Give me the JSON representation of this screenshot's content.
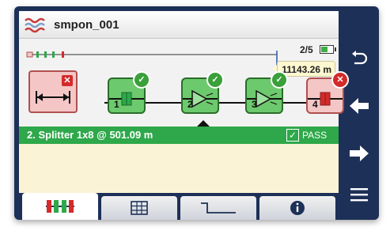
{
  "header": {
    "logo_icon": "wave-logo-icon",
    "title": "smpon_001",
    "page_indicator": "2/5",
    "battery_level": 0.6
  },
  "trace": {
    "cursor_distance": "11143.26 m",
    "launch_status": "fail",
    "events": [
      {
        "number": "1",
        "icon": "connector-icon",
        "status": "pass"
      },
      {
        "number": "2",
        "icon": "splitter-icon",
        "status": "pass"
      },
      {
        "number": "3",
        "icon": "splitter-icon",
        "status": "pass"
      },
      {
        "number": "4",
        "icon": "connector-icon",
        "status": "fail"
      }
    ],
    "selected_event": 2
  },
  "status": {
    "event_summary": "2. Splitter 1x8 @ 501.09 m",
    "verdict": "PASS"
  },
  "tabs": [
    {
      "icon": "link-view-icon",
      "active": true
    },
    {
      "icon": "table-icon",
      "active": false
    },
    {
      "icon": "trace-icon",
      "active": false
    },
    {
      "icon": "info-icon",
      "active": false
    }
  ],
  "side_buttons": [
    "undo-icon",
    "arrow-left-icon",
    "arrow-right-icon",
    "menu-icon"
  ],
  "colors": {
    "pass_green": "#2ea84a",
    "event_green": "#6dc96d",
    "fail_red": "#d42a2a",
    "fail_fill": "#f4c6c6",
    "frame_navy": "#1d3057",
    "detail_cream": "#fbf3d5"
  }
}
